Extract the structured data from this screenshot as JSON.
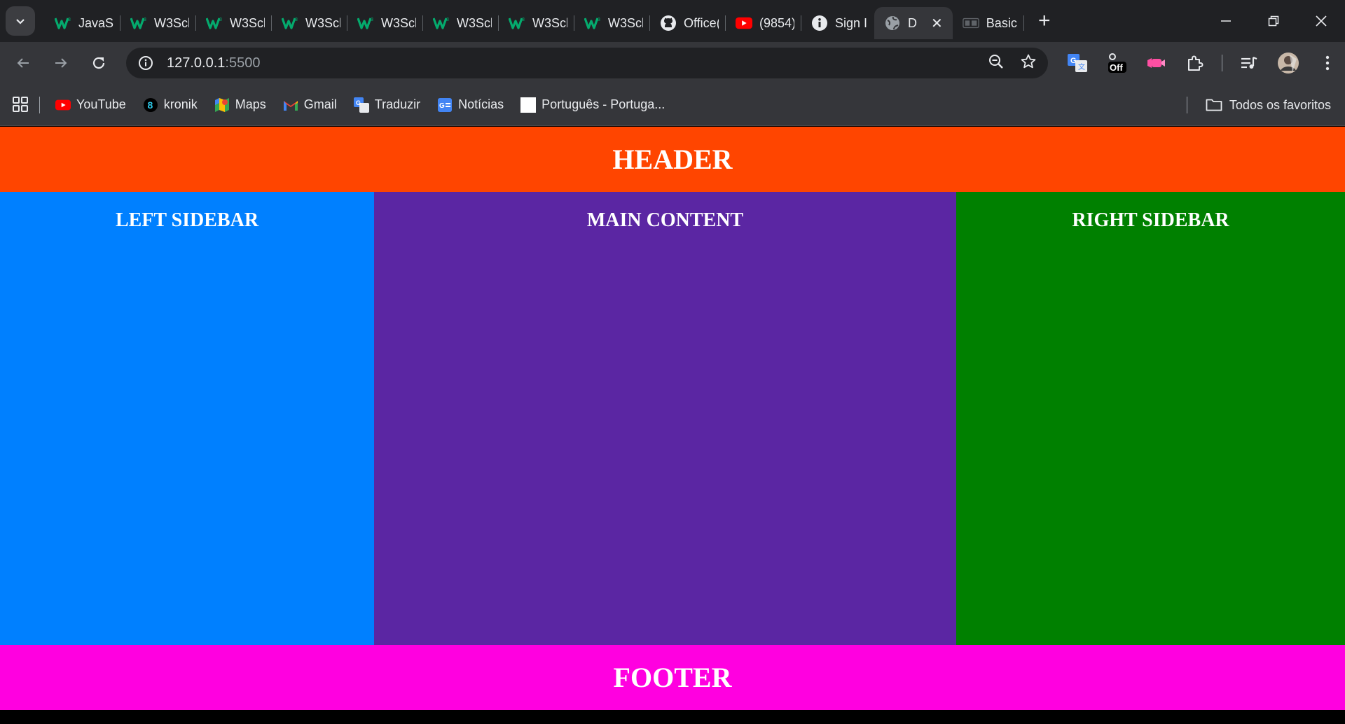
{
  "browser": {
    "tabs": [
      {
        "title": "JavaSc",
        "icon": "w3schools-icon"
      },
      {
        "title": "W3Scl",
        "icon": "w3schools-icon"
      },
      {
        "title": "W3Scl",
        "icon": "w3schools-icon"
      },
      {
        "title": "W3Scl",
        "icon": "w3schools-icon"
      },
      {
        "title": "W3Scl",
        "icon": "w3schools-icon"
      },
      {
        "title": "W3Scl",
        "icon": "w3schools-icon"
      },
      {
        "title": "W3Scl",
        "icon": "w3schools-icon"
      },
      {
        "title": "W3Scl",
        "icon": "w3schools-icon"
      },
      {
        "title": "Office(",
        "icon": "github-icon"
      },
      {
        "title": "(9854)",
        "icon": "youtube-icon"
      },
      {
        "title": "Sign I",
        "icon": "info-icon"
      },
      {
        "title": "D",
        "icon": "globe-icon",
        "active": true
      },
      {
        "title": "Basic",
        "icon": "page-icon"
      }
    ],
    "new_tab_symbol": "+",
    "url_host": "127.0.0.1",
    "url_port": ":5500",
    "extension_badge": "Off",
    "bookmarks": [
      {
        "label": "YouTube",
        "icon": "youtube-icon"
      },
      {
        "label": "kronik",
        "icon": "kronik-icon"
      },
      {
        "label": "Maps",
        "icon": "maps-icon"
      },
      {
        "label": "Gmail",
        "icon": "gmail-icon"
      },
      {
        "label": "Traduzir",
        "icon": "translate-icon"
      },
      {
        "label": "Notícias",
        "icon": "news-icon"
      },
      {
        "label": "Português - Portuga...",
        "icon": "blank-page-icon"
      }
    ],
    "all_bookmarks_label": "Todos os favoritos",
    "colors": {
      "chrome_dark": "#202124",
      "chrome_toolbar": "#35363a"
    }
  },
  "page": {
    "header": "HEADER",
    "left_sidebar": "LEFT SIDEBAR",
    "main_content": "MAIN CONTENT",
    "right_sidebar": "RIGHT SIDEBAR",
    "footer": "FOOTER",
    "colors": {
      "header": "#ff4500",
      "left_sidebar": "#0080ff",
      "main_content": "#5b26a3",
      "right_sidebar": "#008000",
      "footer": "#ff00e0"
    }
  }
}
